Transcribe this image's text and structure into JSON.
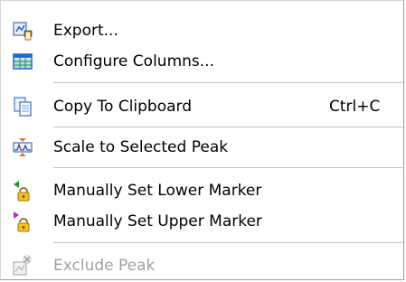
{
  "menu": {
    "items": [
      {
        "label": "Export...",
        "icon": "export-icon"
      },
      {
        "label": "Configure Columns...",
        "icon": "grid-icon"
      },
      {
        "label": "Copy To Clipboard",
        "icon": "clipboard-icon",
        "shortcut": "Ctrl+C"
      },
      {
        "label": "Scale to Selected Peak",
        "icon": "scale-icon"
      },
      {
        "label": "Manually Set Lower Marker",
        "icon": "lower-marker-icon"
      },
      {
        "label": "Manually Set Upper Marker",
        "icon": "upper-marker-icon"
      },
      {
        "label": "Exclude Peak",
        "icon": "exclude-icon",
        "disabled": true
      }
    ]
  }
}
